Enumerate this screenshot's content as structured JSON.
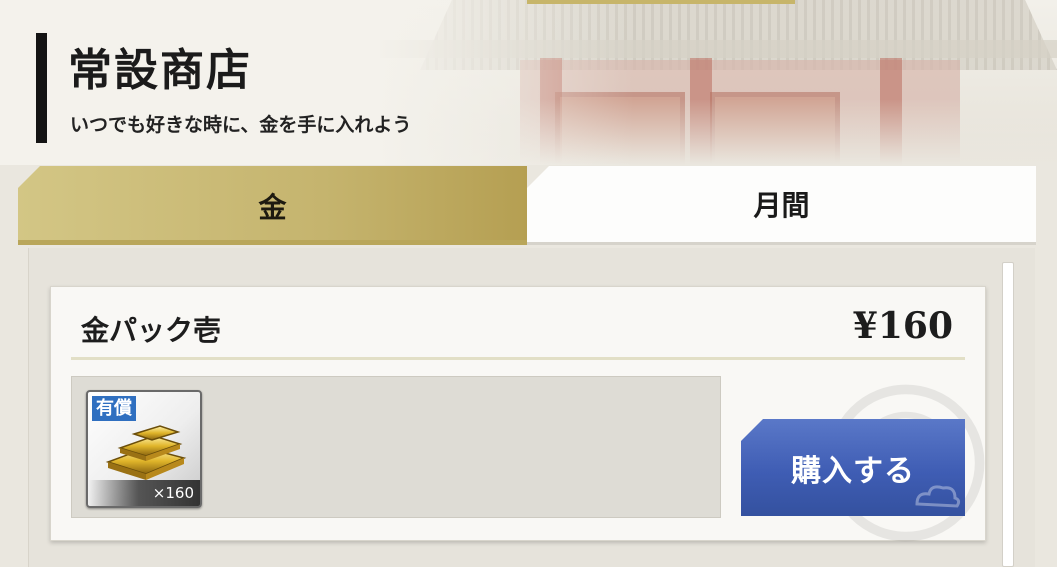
{
  "header": {
    "title": "常設商店",
    "subtitle": "いつでも好きな時に、金を手に入れよう"
  },
  "tabs": [
    {
      "label": "金",
      "active": true
    },
    {
      "label": "月間",
      "active": false
    }
  ],
  "product": {
    "name": "金パック壱",
    "price": "¥160",
    "items": [
      {
        "icon": "gold-bars-icon",
        "badge": "有償",
        "quantity": "×160"
      }
    ],
    "buy_label": "購入する"
  },
  "colors": {
    "gold_tab": "#c5b46e",
    "buy_button": "#3f5db4",
    "badge": "#2f6fc0"
  }
}
